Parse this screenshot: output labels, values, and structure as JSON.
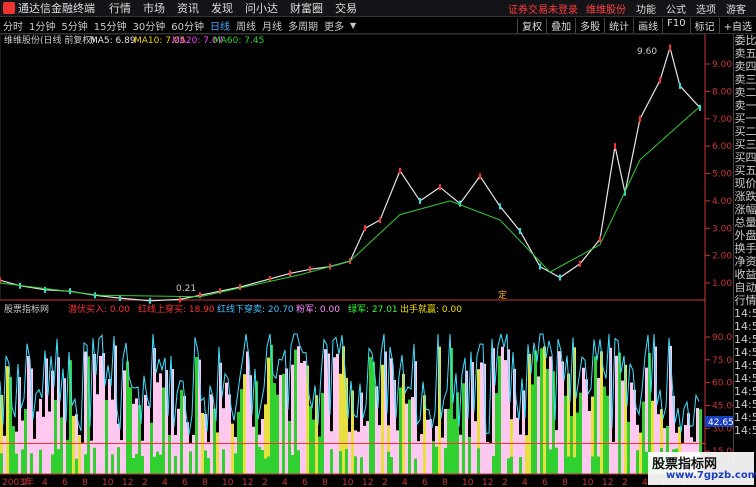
{
  "window": {
    "app_title": "通达信金融终端",
    "menus": [
      "行情",
      "市场",
      "资讯",
      "发现",
      "问小达",
      "财富圈",
      "交易"
    ],
    "alert_text": "证券交易未登录",
    "stock_link": "维维股份",
    "right_menus": [
      "功能",
      "公式",
      "选项",
      "游客"
    ]
  },
  "periods": {
    "items": [
      "分时",
      "1分钟",
      "5分钟",
      "15分钟",
      "30分钟",
      "60分钟",
      "日线",
      "周线",
      "月线",
      "多周期",
      "更多"
    ],
    "active": "日线"
  },
  "toolbar": [
    "复权",
    "叠加",
    "多股",
    "统计",
    "画线",
    "F10",
    "标记",
    "+自选"
  ],
  "main_chart": {
    "label": "维维股份(日线 前复权)",
    "ma": [
      {
        "name": "MA5",
        "value": "6.89",
        "color": "#e6e6e6"
      },
      {
        "name": "MA10",
        "value": "7.05",
        "color": "#f0d000"
      },
      {
        "name": "MA20",
        "value": "7.07",
        "color": "#ff40ff"
      },
      {
        "name": "MA60",
        "value": "7.45",
        "color": "#30d030"
      }
    ],
    "y_ticks": [
      "9.00",
      "8.00",
      "7.00",
      "6.00",
      "5.00",
      "4.00",
      "3.00",
      "2.00",
      "1.00"
    ],
    "peak_label": "9.60",
    "low_label": "0.21",
    "mark_label": "定"
  },
  "indicator": {
    "name": "股票指标网",
    "items": [
      {
        "label": "潜伏买入",
        "value": "0.00",
        "color": "#ff3030"
      },
      {
        "label": "红线上穿买",
        "value": "18.90",
        "color": "#ff3030"
      },
      {
        "label": "红线下穿卖",
        "value": "20.70",
        "color": "#40c0ff"
      },
      {
        "label": "粉军",
        "value": "0.00",
        "color": "#ff90ff"
      },
      {
        "label": "绿军",
        "value": "27.01",
        "color": "#30ff30"
      },
      {
        "label": "出手就赢",
        "value": "0.00",
        "color": "#f0e000"
      }
    ],
    "y_ticks": [
      "90.00",
      "75.00",
      "60.00",
      "45.00",
      "30.00",
      "15.00"
    ],
    "current_value": "42.65"
  },
  "x_axis": [
    "2003年",
    "2",
    "4",
    "6",
    "8",
    "10",
    "12",
    "2",
    "4",
    "6",
    "8",
    "10",
    "12",
    "2",
    "4",
    "6",
    "8",
    "10",
    "12",
    "2",
    "4",
    "6",
    "8",
    "10",
    "12",
    "2",
    "4",
    "6",
    "8",
    "10",
    "12",
    "2",
    "4",
    "6",
    "8"
  ],
  "side_panel": [
    "委比",
    "卖五",
    "卖四",
    "卖三",
    "卖二",
    "卖一",
    "买一",
    "买二",
    "买三",
    "买四",
    "买五",
    "现价",
    "涨跌",
    "涨幅",
    "总量",
    "外盘",
    "换手",
    "净资",
    "收益",
    "",
    "自动",
    "行情",
    "14:5",
    "14:5",
    "14:5",
    "14:5",
    "14:5",
    "14:5",
    "14:5",
    "14:5",
    "14:5",
    "14:5"
  ],
  "watermark": {
    "line1": "股票指标网",
    "line2": "www.7gpzb.com"
  },
  "chart_data": [
    {
      "type": "line",
      "title": "维维股份(日线 前复权)",
      "ylim": [
        0.21,
        9.6
      ],
      "series": [
        {
          "name": "price",
          "x": [
            0,
            20,
            45,
            70,
            95,
            120,
            150,
            180,
            200,
            220,
            240,
            270,
            290,
            310,
            330,
            350,
            365,
            380,
            400,
            420,
            440,
            460,
            480,
            500,
            520,
            540,
            560,
            580,
            600,
            615,
            625,
            640,
            660,
            670,
            680,
            700
          ],
          "values": [
            1.1,
            0.9,
            0.75,
            0.7,
            0.55,
            0.45,
            0.35,
            0.4,
            0.55,
            0.7,
            0.85,
            1.15,
            1.35,
            1.5,
            1.6,
            1.8,
            3.0,
            3.3,
            5.1,
            4.0,
            4.5,
            3.9,
            4.9,
            3.8,
            2.9,
            1.6,
            1.2,
            1.7,
            2.6,
            6.0,
            4.3,
            7.0,
            8.4,
            9.6,
            8.2,
            7.4
          ]
        },
        {
          "name": "MA60",
          "x": [
            0,
            100,
            200,
            300,
            350,
            400,
            450,
            500,
            550,
            600,
            640,
            700
          ],
          "values": [
            1.0,
            0.55,
            0.5,
            1.3,
            1.8,
            3.5,
            4.0,
            3.3,
            1.4,
            2.4,
            5.5,
            7.45
          ]
        }
      ]
    },
    {
      "type": "area",
      "title": "股票指标网",
      "ylim": [
        0,
        100
      ],
      "note_series": [
        "pink",
        "green",
        "yellow",
        "cyan line"
      ],
      "series": [
        {
          "name": "红线上穿买",
          "values": [
            18.9
          ]
        },
        {
          "name": "红线下穿卖",
          "values": [
            20.7
          ]
        },
        {
          "name": "绿军",
          "values": [
            27.01
          ]
        }
      ]
    }
  ]
}
